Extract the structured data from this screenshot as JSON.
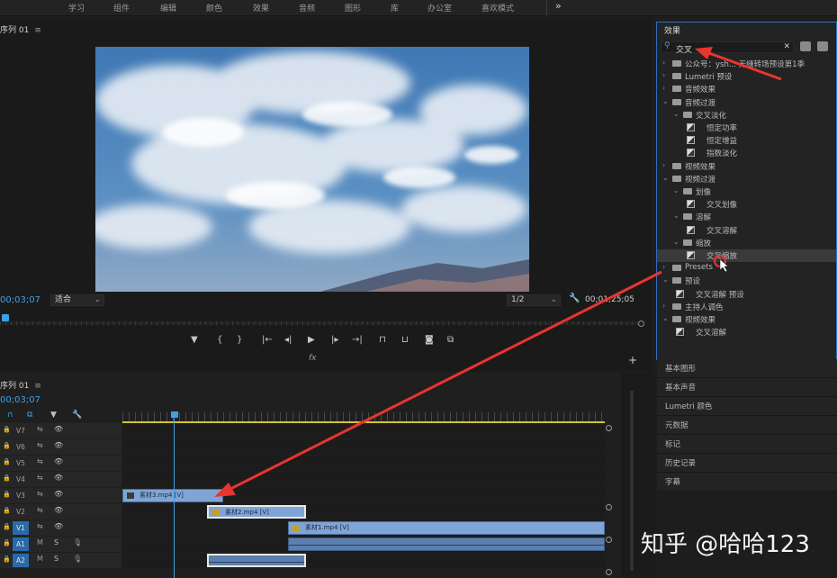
{
  "topbar": {
    "workspaces": [
      "学习",
      "组件",
      "编辑",
      "颜色",
      "效果",
      "音频",
      "图形",
      "库",
      "办公室",
      "喜欢模式"
    ],
    "more": "»"
  },
  "monitor": {
    "tab": "序列 01",
    "menu_icon": "≡",
    "timecode_current": "00;03;07",
    "fit": "适合",
    "resolution": "1/2",
    "timecode_duration": "00;01;25;05",
    "fx_label": "fx",
    "add_button": "+"
  },
  "effects": {
    "title": "效果",
    "search_value": "交叉",
    "tree": [
      {
        "indent": 0,
        "kind": "folder",
        "open": false,
        "label": "公众号：ysh... 无缝转场预设第1季"
      },
      {
        "indent": 0,
        "kind": "folder",
        "open": false,
        "label": "Lumetri 预设"
      },
      {
        "indent": 0,
        "kind": "folder",
        "open": false,
        "label": "音频效果"
      },
      {
        "indent": 0,
        "kind": "folder",
        "open": true,
        "label": "音频过渡"
      },
      {
        "indent": 1,
        "kind": "folder",
        "open": true,
        "label": "交叉淡化"
      },
      {
        "indent": 2,
        "kind": "preset",
        "label": "恒定功率"
      },
      {
        "indent": 2,
        "kind": "preset",
        "label": "恒定增益"
      },
      {
        "indent": 2,
        "kind": "preset",
        "label": "指数淡化"
      },
      {
        "indent": 0,
        "kind": "folder",
        "open": false,
        "label": "视频效果"
      },
      {
        "indent": 0,
        "kind": "folder",
        "open": true,
        "label": "视频过渡"
      },
      {
        "indent": 1,
        "kind": "folder",
        "open": true,
        "label": "划像"
      },
      {
        "indent": 2,
        "kind": "preset",
        "label": "交叉划像"
      },
      {
        "indent": 1,
        "kind": "folder",
        "open": true,
        "label": "溶解"
      },
      {
        "indent": 2,
        "kind": "preset",
        "label": "交叉溶解"
      },
      {
        "indent": 1,
        "kind": "folder",
        "open": true,
        "label": "缩放"
      },
      {
        "indent": 2,
        "kind": "preset",
        "label": "交叉缩放",
        "selected": true
      },
      {
        "indent": 0,
        "kind": "folder",
        "open": false,
        "label": "Presets"
      },
      {
        "indent": 0,
        "kind": "folder",
        "open": true,
        "label": "预设"
      },
      {
        "indent": 1,
        "kind": "preset",
        "label": "交叉溶解 预设"
      },
      {
        "indent": 0,
        "kind": "folder",
        "open": false,
        "label": "主持人调色"
      },
      {
        "indent": 0,
        "kind": "folder",
        "open": true,
        "label": "视频效果"
      },
      {
        "indent": 1,
        "kind": "preset",
        "label": "交叉溶解"
      }
    ]
  },
  "side_panels": [
    "基本图形",
    "基本声音",
    "Lumetri 颜色",
    "元数据",
    "标记",
    "历史记录",
    "字幕"
  ],
  "timeline": {
    "tab": "序列 01",
    "timecode": "00;03;07",
    "tracks": [
      "V7",
      "V6",
      "V5",
      "V4",
      "V3",
      "V2",
      "V1",
      "A1",
      "A2"
    ],
    "clips": [
      {
        "track": "V3",
        "label": "素材3.mp4 [V]"
      },
      {
        "track": "V2",
        "label": "素材2.mp4 [V]"
      },
      {
        "track": "V1",
        "label": "素材1.mp4 [V]"
      }
    ],
    "audio_labels": {
      "mute": "M",
      "solo": "S"
    }
  },
  "watermark": "知乎 @哈哈123",
  "colors": {
    "accent": "#3ea0e8",
    "clip": "#7fa4d6",
    "arrow": "#e8352e"
  }
}
